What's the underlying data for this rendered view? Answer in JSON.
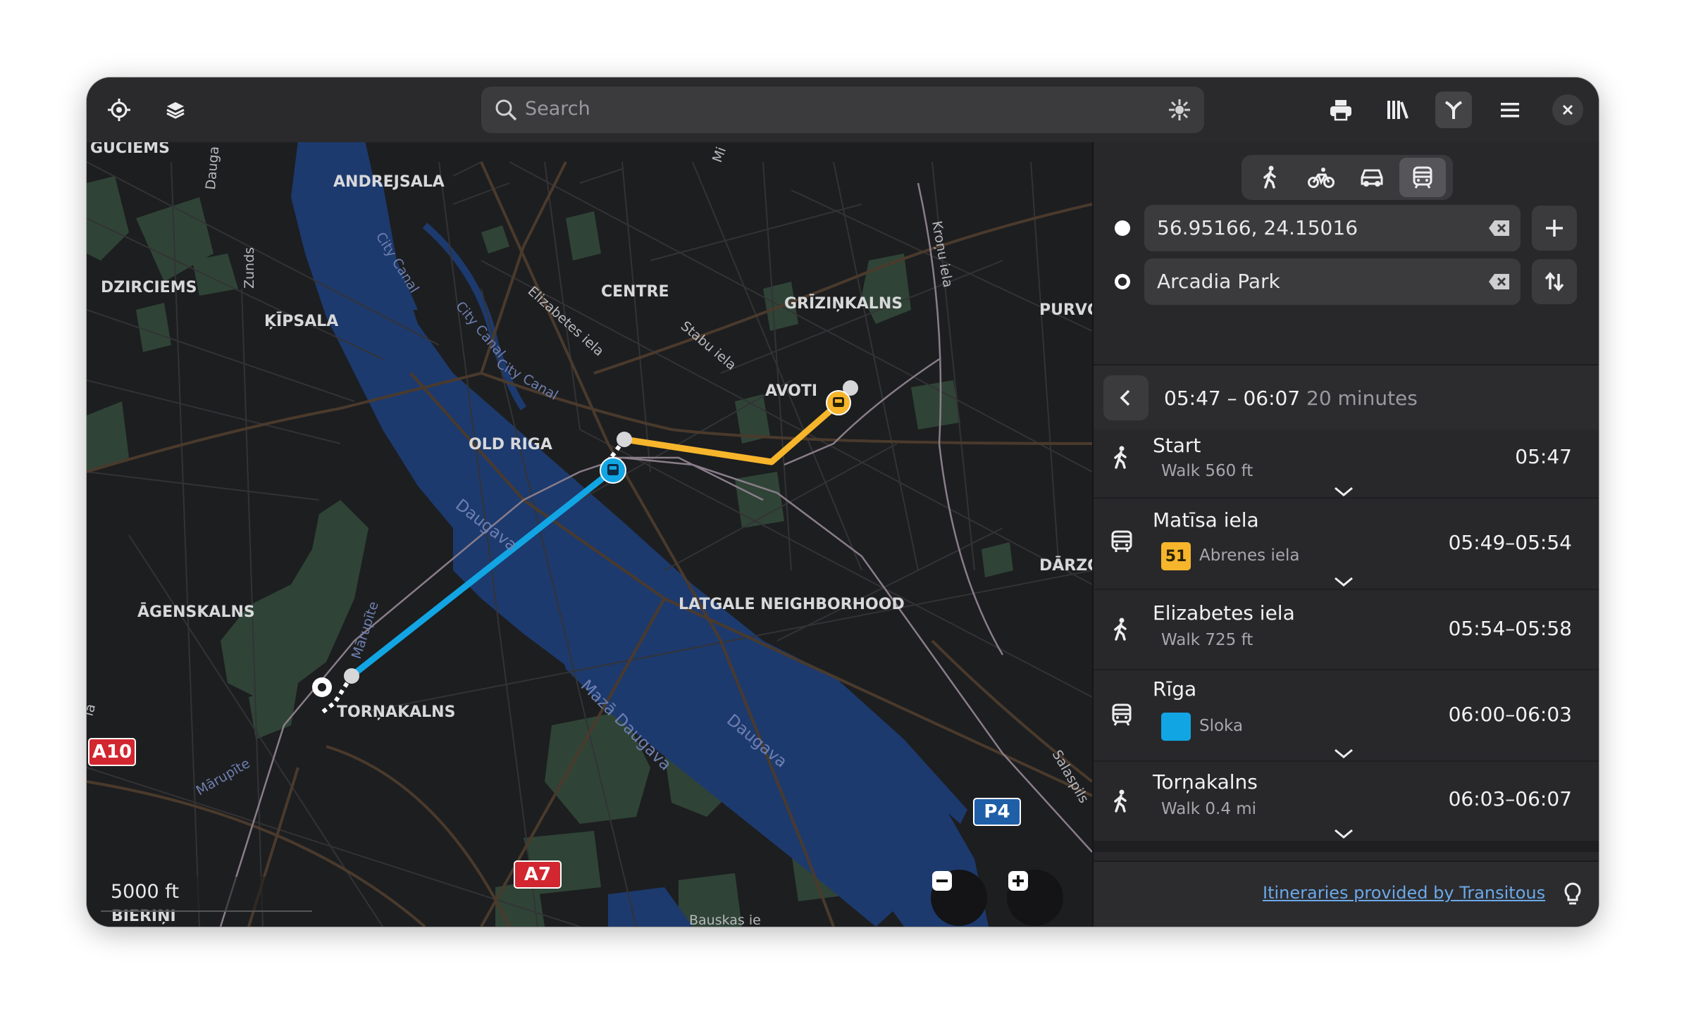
{
  "search": {
    "placeholder": "Search"
  },
  "map": {
    "labels": {
      "andrejsala": "ANDREJSALA",
      "dzirciems": "DZIRCIEMS",
      "kipsala": "ĶĪPSALA",
      "centre": "CENTRE",
      "grizinkalns": "GRĪZIŅKALNS",
      "purvc": "PURVC",
      "avoti": "AVOTI",
      "old_riga": "OLD RIGA",
      "agenskalns": "ĀGENSKALNS",
      "latgale": "LATGALE NEIGHBORHOOD",
      "darzc": "DĀRZC",
      "tornakalns": "TORŅAKALNS",
      "bierini": "BIERIŅI",
      "guciems": "GUCIEMS",
      "dauga": "Dauga",
      "zunds": "Zunds",
      "city_canal_1": "City Canal",
      "city_canal_2": "City Canal",
      "city_canal_3": "City Canal",
      "elizabetes": "Elizabetes iela",
      "stabu": "Stabu iela",
      "kronu": "Kroņu iela",
      "daugava_1": "Daugava",
      "daugava_2": "Daugava",
      "maza_daugava": "Mazā Daugava",
      "marupite_1": "Mārupīte",
      "marupite_2": "Mārupīte",
      "salaspils": "Salaspils",
      "mi": "Mi",
      "la": "la",
      "rauskas": "Bauskas ie"
    },
    "shields": {
      "a10": "A10",
      "a7": "A7",
      "p4": "P4"
    },
    "scale": "5000 ft"
  },
  "colors": {
    "walk": "#ffffff",
    "bus": "#f7b52c",
    "train": "#12a5e4",
    "water": "#1d3a6e",
    "park": "#2f4437"
  },
  "route": {
    "from": "56.95166, 24.15016",
    "to": "Arcadia Park",
    "time_range": "05:47 – 06:07",
    "duration": "20 minutes",
    "legs": [
      {
        "name": "Start",
        "sub": "Walk 560 ft",
        "time": "05:47",
        "icon": "walk-icon"
      },
      {
        "name": "Matīsa iela",
        "badge": "51",
        "sub": "Abrenes iela",
        "time": "05:49–05:54",
        "icon": "bus-icon"
      },
      {
        "name": "Elizabetes iela",
        "sub": "Walk 725 ft",
        "time": "05:54–05:58",
        "icon": "walk-icon"
      },
      {
        "name": "Rīga",
        "sub": "Sloka",
        "time": "06:00–06:03",
        "icon": "train-icon"
      },
      {
        "name": "Torņakalns",
        "sub": "Walk 0.4 mi",
        "time": "06:03–06:07",
        "icon": "walk-icon"
      }
    ]
  },
  "footer": {
    "credit": "Itineraries provided by Transitous"
  }
}
